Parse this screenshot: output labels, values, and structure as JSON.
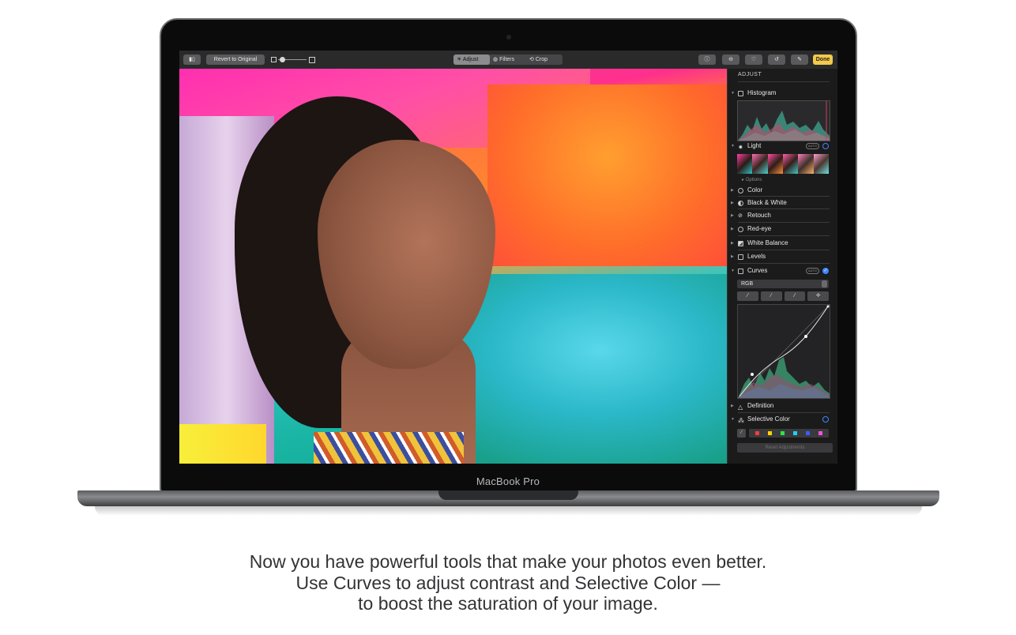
{
  "laptop": {
    "brand": "MacBook Pro"
  },
  "toolbar": {
    "revert_label": "Revert to Original",
    "tabs": [
      "Adjust",
      "Filters",
      "Crop"
    ],
    "active_tab": "Adjust",
    "done_label": "Done"
  },
  "sidebar": {
    "title": "ADJUST",
    "histogram_label": "Histogram",
    "light_label": "Light",
    "auto_label": "AUTO",
    "options_label": "Options",
    "items": [
      "Color",
      "Black & White",
      "Retouch",
      "Red-eye",
      "White Balance",
      "Levels"
    ],
    "curves_label": "Curves",
    "rgb_value": "RGB",
    "definition_label": "Definition",
    "selective_color_label": "Selective Color",
    "reset_label": "Reset Adjustments"
  },
  "colors": {
    "done": "#f2c94c",
    "accent": "#3d86ff",
    "swatches": [
      "#ff3b3b",
      "#ffd400",
      "#2ee34a",
      "#19d3ff",
      "#3b5bff",
      "#ff4fe0"
    ]
  },
  "caption": {
    "line1": "Now you have powerful tools that make your photos even better.",
    "line2": "Use Curves to adjust contrast and Selective Color —",
    "line3": "to boost the saturation of your image."
  }
}
